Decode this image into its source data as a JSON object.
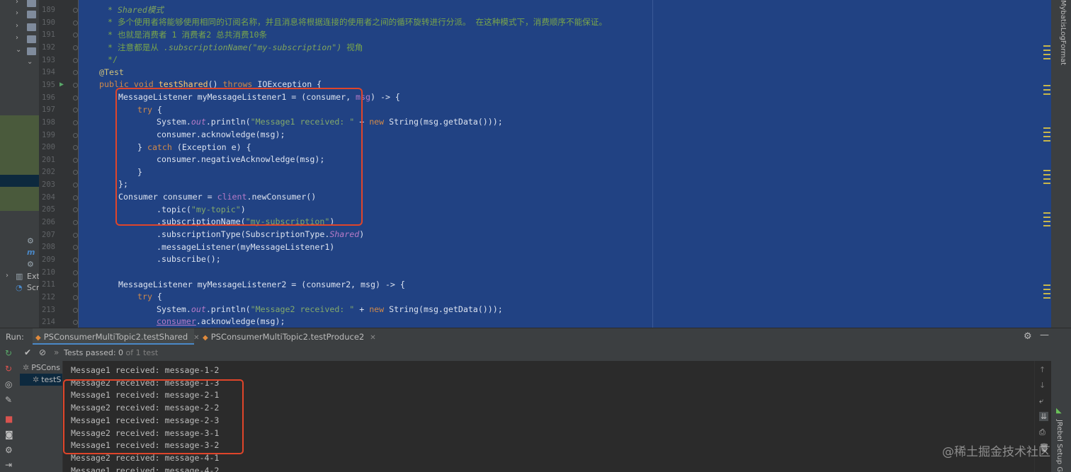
{
  "project_tree": {
    "visible_labels": [
      "Ext",
      "Scr"
    ]
  },
  "gutter": {
    "line_numbers": [
      "189",
      "190",
      "191",
      "192",
      "193",
      "194",
      "195",
      "196",
      "197",
      "198",
      "199",
      "200",
      "201",
      "202",
      "203",
      "204",
      "205",
      "206",
      "207",
      "208",
      "209",
      "210",
      "211",
      "212",
      "213",
      "214"
    ]
  },
  "editor": {
    "comment_1": " * Shared模式",
    "comment_2": " * 多个使用者将能够使用相同的订阅名称，并且消息将根据连接的使用者之间的循环旋转进行分派。 在这种模式下，消费顺序不能保证。",
    "comment_3": " * 也就是消费者 1 消费者2 总共消费10条",
    "comment_4a": " * 注意都是从 ",
    "comment_4b": ".subscriptionName(\"my-subscription\")",
    "comment_4c": " 视角",
    "comment_5": " */",
    "annotation": "@Test",
    "method_kw": "public void ",
    "method_name": "testShared",
    "method_rest": "() ",
    "throws_kw": "throws ",
    "throws_type": "IOException {",
    "l196a": "MessageListener myMessageListener1 = (consumer, ",
    "l196b": "msg",
    "l196c": ") -> {",
    "try_kw": "try",
    "brace_open": " {",
    "l198a": "System.",
    "l198b": "out",
    "l198c": ".println(",
    "l198d": "\"Message1 received: \"",
    "l198e": " + ",
    "new_kw": "new",
    "l198f": " String(msg.getData()));",
    "l199": "consumer.acknowledge(msg);",
    "l200a": "} ",
    "catch_kw": "catch",
    "l200b": " (Exception e) {",
    "l201": "consumer.negativeAcknowledge(msg);",
    "close_brace": "}",
    "close_lambda": "};",
    "l204a": "Consumer consumer = ",
    "l204b": "client",
    "l204c": ".newConsumer()",
    "l205a": ".topic(",
    "l205b": "\"my-topic\"",
    "l205c": ")",
    "l206a": ".subscriptionName(",
    "l206b": "\"my-subscription\"",
    "l206c": ")",
    "l207a": ".subscriptionType(SubscriptionType.",
    "l207b": "Shared",
    "l207c": ")",
    "l208": ".messageListener(myMessageListener1)",
    "l209": ".subscribe();",
    "l211a": "MessageListener myMessageListener2 = (consumer2, msg) -> {",
    "l213d": "\"Message2 received: \"",
    "l214a": "consumer",
    "l214b": ".acknowledge(msg);"
  },
  "right_stripe": {
    "tool_label": "MybatisLogFormat",
    "bottom_tool_label": "JRebel Setup Gui"
  },
  "run_panel": {
    "label": "Run:",
    "tabs": [
      {
        "label": "PSConsumerMultiTopic2.testShared",
        "active": true
      },
      {
        "label": "PSConsumerMultiTopic2.testProduce2",
        "active": false
      }
    ],
    "status_prefix": "Tests passed: ",
    "status_count": "0",
    "status_suffix": " of 1 test",
    "test_tree": [
      {
        "label": "PSCons"
      },
      {
        "label": "testS"
      }
    ],
    "console_lines": [
      "Message1 received: message-1-2",
      "Message2 received: message-1-3",
      "Message1 received: message-2-1",
      "Message2 received: message-2-2",
      "Message1 received: message-2-3",
      "Message2 received: message-3-1",
      "Message1 received: message-3-2",
      "Message2 received: message-4-1",
      "Message1 received: message-4-2"
    ]
  },
  "watermark": "@稀土掘金技术社区",
  "colors": {
    "editor_selection": "#214283",
    "highlight_box": "#e0452a",
    "panel_bg": "#3c3f41",
    "console_bg": "#2b2b2b"
  },
  "icons": [
    "run-gutter-icon",
    "settings-gear-icon",
    "minimize-icon",
    "rerun-icon",
    "check-icon",
    "stop-icon",
    "wrap-icon",
    "scroll-to-end-icon",
    "print-icon",
    "trash-icon",
    "spinner-icon"
  ]
}
